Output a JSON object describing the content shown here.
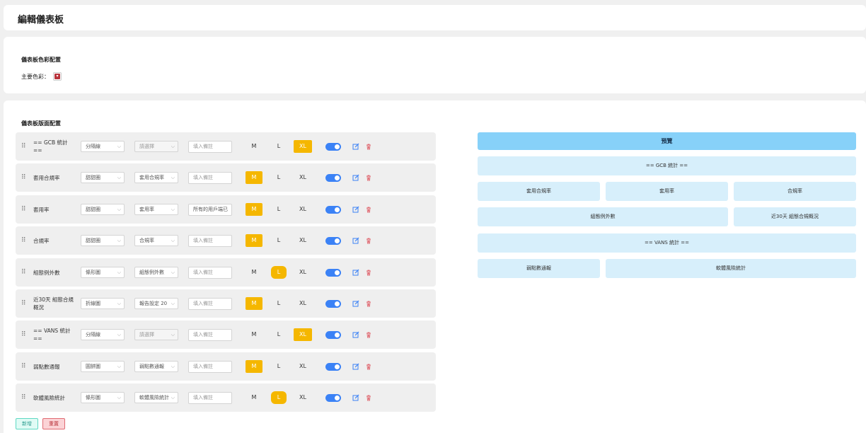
{
  "page": {
    "title": "編輯儀表板"
  },
  "color_section": {
    "title": "儀表板色彩配置",
    "primary_label": "主要色彩：",
    "primary_color": "#b8333b"
  },
  "layout_section": {
    "title": "儀表板版面配置"
  },
  "rows": [
    {
      "name": "== GCB 統計 ==",
      "type": "分隔線",
      "source": "請選擇",
      "source_disabled": true,
      "note": "",
      "note_placeholder": "填入備註",
      "size": "XL"
    },
    {
      "name": "套用合規率",
      "type": "甜甜圈",
      "source": "套用合規率",
      "source_disabled": false,
      "note": "",
      "note_placeholder": "填入備註",
      "size": "M"
    },
    {
      "name": "套用率",
      "type": "甜甜圈",
      "source": "套用率",
      "source_disabled": false,
      "note": "所有的用戶端已",
      "note_placeholder": "填入備註",
      "size": "M"
    },
    {
      "name": "合規率",
      "type": "甜甜圈",
      "source": "合規率",
      "source_disabled": false,
      "note": "",
      "note_placeholder": "填入備註",
      "size": "M"
    },
    {
      "name": "組態例外數",
      "type": "條形圖",
      "source": "組態例外數",
      "source_disabled": false,
      "note": "",
      "note_placeholder": "填入備註",
      "size": "L"
    },
    {
      "name": "近30天 組態合規概況",
      "type": "折線圖",
      "source": "報告設定 20",
      "source_disabled": false,
      "note": "",
      "note_placeholder": "填入備註",
      "size": "M"
    },
    {
      "name": "== VANS 統計 ==",
      "type": "分隔線",
      "source": "請選擇",
      "source_disabled": true,
      "note": "",
      "note_placeholder": "填入備註",
      "size": "XL"
    },
    {
      "name": "弱點數通報",
      "type": "圓餅圖",
      "source": "弱點數通報",
      "source_disabled": false,
      "note": "",
      "note_placeholder": "填入備註",
      "size": "M"
    },
    {
      "name": "軟體風險統計",
      "type": "條形圖",
      "source": "軟體風險統計",
      "source_disabled": false,
      "note": "",
      "note_placeholder": "填入備註",
      "size": "L"
    }
  ],
  "size_labels": {
    "m": "M",
    "l": "L",
    "xl": "XL"
  },
  "buttons": {
    "add": "新增",
    "reset": "重置"
  },
  "preview": {
    "title": "預覽",
    "blocks": [
      {
        "label": "== GCB 統計 =="
      },
      {
        "label": "套用合規率"
      },
      {
        "label": "套用率"
      },
      {
        "label": "合規率"
      },
      {
        "label": "組態例外數"
      },
      {
        "label": "近30天 組態合規概況"
      },
      {
        "label": "== VANS 統計 =="
      },
      {
        "label": "弱點數通報"
      },
      {
        "label": "軟體風險統計"
      }
    ]
  },
  "colors": {
    "accent": "#f5b700",
    "toggle": "#3b82f6",
    "preview_header": "#87d1f9",
    "preview_block": "#d7effb"
  }
}
